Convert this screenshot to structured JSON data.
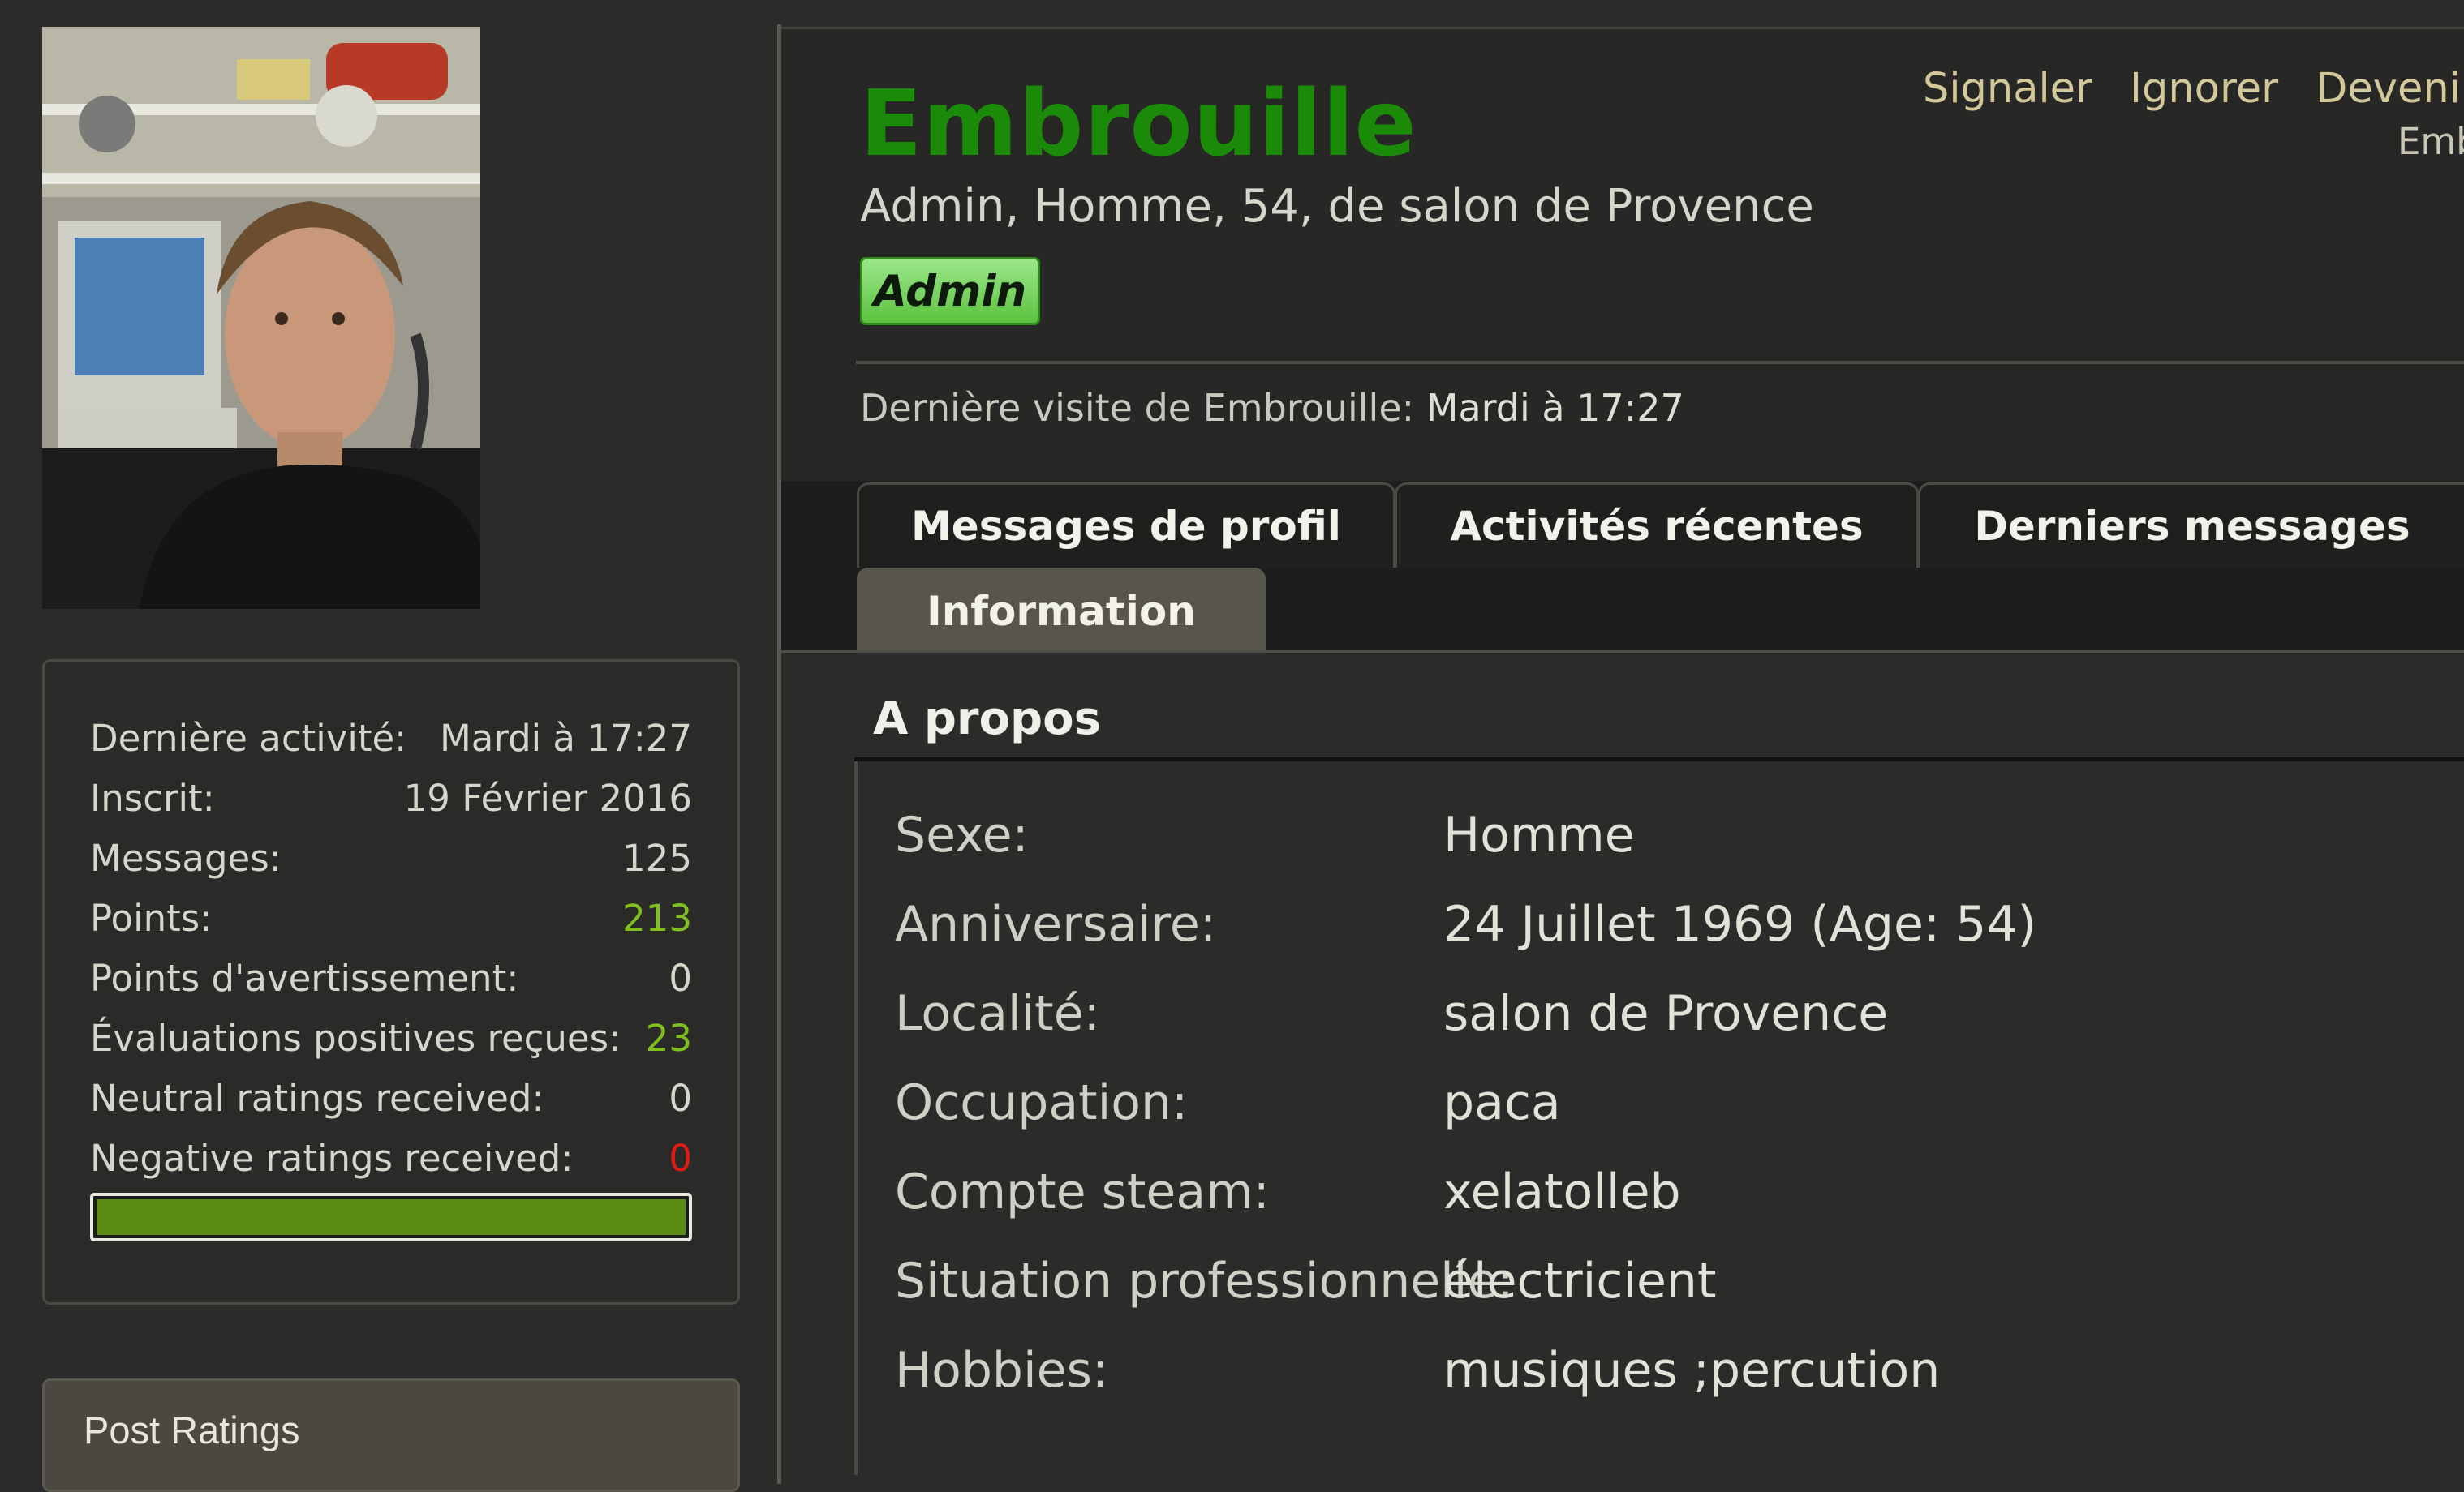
{
  "profile": {
    "username": "Embrouille",
    "info_line": "Admin, Homme, 54, de salon de Provence",
    "badge": "Admin",
    "last_visit_label": "Dernière visite de Embrouille:",
    "last_visit_value": "Mardi à 17:27",
    "actions": {
      "report": "Signaler",
      "ignore": "Ignorer",
      "follow": "Devenir fan",
      "subtext": "Emb"
    }
  },
  "stats": [
    {
      "label": "Dernière activité:",
      "value": "Mardi à 17:27"
    },
    {
      "label": "Inscrit:",
      "value": "19 Février 2016"
    },
    {
      "label": "Messages:",
      "value": "125"
    },
    {
      "label": "Points:",
      "value": "213"
    },
    {
      "label": "Points d'avertissement:",
      "value": "0"
    },
    {
      "label": "Évaluations positives reçues:",
      "value": "23"
    },
    {
      "label": "Neutral ratings received:",
      "value": "0"
    },
    {
      "label": "Negative ratings received:",
      "value": "0"
    }
  ],
  "rating_bar": {
    "positive_fraction": 1.0,
    "color": "#5c8d12"
  },
  "post_ratings": {
    "title": "Post Ratings"
  },
  "tabs": [
    {
      "label": "Messages de profil"
    },
    {
      "label": "Activités récentes"
    },
    {
      "label": "Derniers messages"
    },
    {
      "label": "Information",
      "active": true
    }
  ],
  "about": {
    "title": "A propos",
    "rows": [
      {
        "label": "Sexe:",
        "value": "Homme"
      },
      {
        "label": "Anniversaire:",
        "value": "24 Juillet 1969 (Age: 54)"
      },
      {
        "label": "Localité:",
        "value": "salon de Provence"
      },
      {
        "label": "Occupation:",
        "value": "paca"
      },
      {
        "label": "Compte steam:",
        "value": "xelatolleb"
      },
      {
        "label": "Situation professionnelle:",
        "value": "électricient"
      },
      {
        "label": "Hobbies:",
        "value": "musiques ;percution"
      }
    ]
  },
  "colors": {
    "username": "#1a8a08",
    "positive_value": "#7fbf1e",
    "negative_value": "#e11b14",
    "links": "#d2c89a"
  }
}
